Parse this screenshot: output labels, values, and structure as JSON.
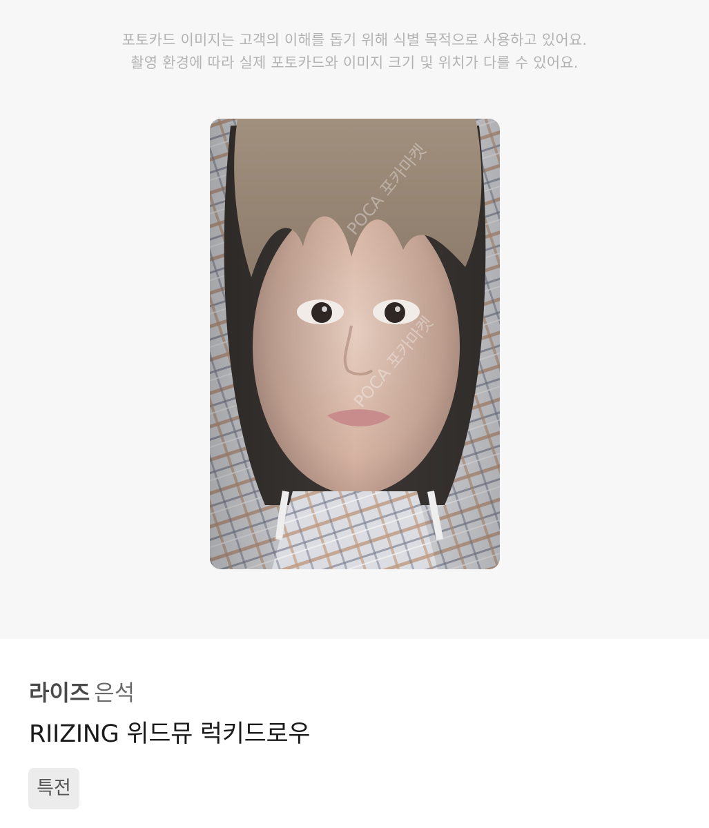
{
  "notice": {
    "line1": "포토카드 이미지는 고객의 이해를 돕기 위해 식별 목적으로 사용하고 있어요.",
    "line2": "촬영 환경에 따라 실제 포토카드와 이미지 크기 및 위치가 다를 수 있어요."
  },
  "photocard": {
    "watermark": "POCA 포카마켓"
  },
  "product": {
    "group": "라이즈",
    "member": "은석",
    "title": "RIIZING 위드뮤 럭키드로우",
    "tag": "특전"
  },
  "colors": {
    "image_background": "#f7f7f7",
    "notice_text": "#b3b3b3",
    "tag_background": "#ececec"
  }
}
